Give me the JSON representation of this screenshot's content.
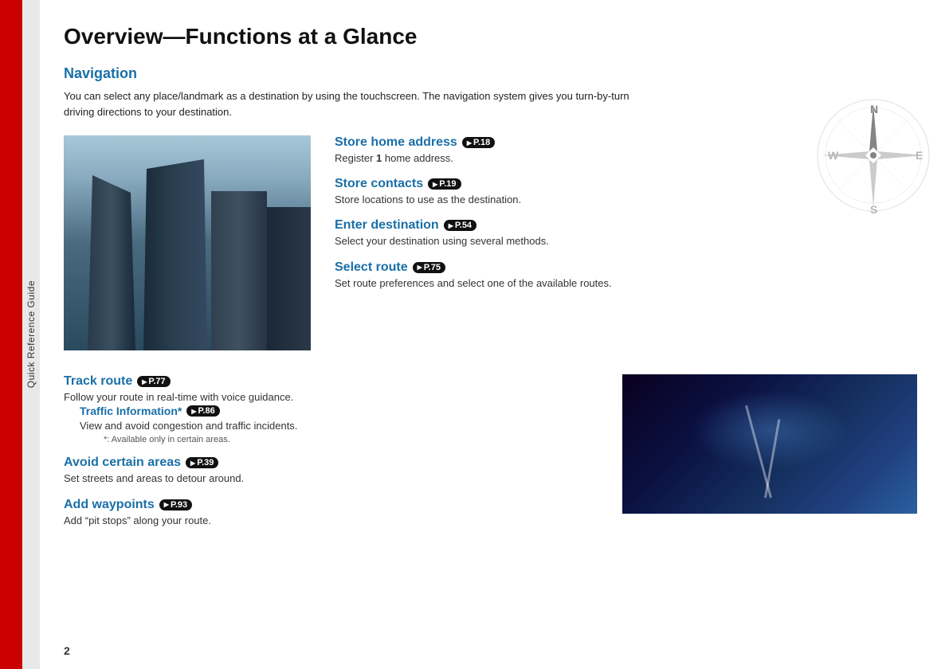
{
  "sidebar": {
    "label": "Quick Reference Guide"
  },
  "page": {
    "title": "Overview—Functions at a Glance",
    "number": "2"
  },
  "navigation_section": {
    "heading": "Navigation",
    "intro": "You can select any place/landmark as a destination by using the touchscreen. The navigation system gives you turn-by-turn driving directions to your destination.",
    "items": [
      {
        "id": "store-home",
        "title": "Store home address",
        "badge": "P.18",
        "description": "Register 1 home address."
      },
      {
        "id": "store-contacts",
        "title": "Store contacts",
        "badge": "P.19",
        "description": "Store locations to use as the destination."
      },
      {
        "id": "enter-destination",
        "title": "Enter destination",
        "badge": "P.54",
        "description": "Select your destination using several methods."
      },
      {
        "id": "select-route",
        "title": "Select route",
        "badge": "P.75",
        "description": "Set route preferences and select one of the available routes."
      }
    ]
  },
  "bottom_section": {
    "items": [
      {
        "id": "track-route",
        "title": "Track route",
        "badge": "P.77",
        "description": "Follow your route in real-time with voice guidance.",
        "sub_items": [
          {
            "id": "traffic-info",
            "title": "Traffic Information*",
            "badge": "P.86",
            "description": "View and avoid congestion and traffic incidents.",
            "asterisk": "*: Available only in certain areas."
          }
        ]
      },
      {
        "id": "avoid-areas",
        "title": "Avoid certain areas",
        "badge": "P.39",
        "description": "Set streets and areas to detour around."
      },
      {
        "id": "add-waypoints",
        "title": "Add waypoints",
        "badge": "P.93",
        "description": "Add “pit stops” along your route."
      }
    ]
  }
}
